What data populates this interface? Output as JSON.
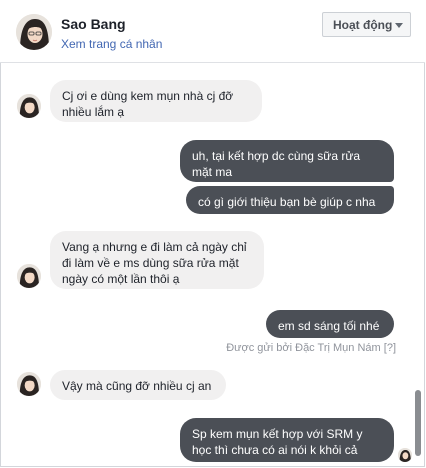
{
  "header": {
    "name": "Sao Bang",
    "profile_link": "Xem trang cá nhân",
    "status_button": "Hoạt động"
  },
  "messages": [
    {
      "side": "in",
      "text_lines": [
        "Cj ơi e dùng kem mụn nhà cj đỡ",
        "nhiều lắm ạ"
      ]
    },
    {
      "side": "out",
      "text_lines": [
        "uh, tại kết hợp dc cùng sữa rửa",
        "mặt ma"
      ]
    },
    {
      "side": "out",
      "text_lines": [
        "có gì giới thiệu  bạn bè giúp c nha"
      ]
    },
    {
      "side": "in",
      "text_lines": [
        "Vang ạ nhưng e đi làm cả ngày chỉ",
        "đi làm về e ms dùng sữa rửa mặt",
        "ngày có một lần thôi ạ"
      ]
    },
    {
      "side": "out",
      "text_lines": [
        "em sd sáng tối nhé"
      ]
    },
    {
      "side": "in",
      "text_lines": [
        "Vậy mà cũng đỡ nhiều cj an"
      ]
    },
    {
      "side": "out",
      "text_lines": [
        "Sp kem mụn kết hợp với SRM y",
        "học thì chưa có ai nói k khỏi cả"
      ]
    }
  ],
  "sent_by": "Được gửi bởi Đặc Trị Mụn Nám",
  "sent_by_help": "[?]",
  "icons": {
    "status_caret": "chevron-down-icon",
    "avatar": "user-avatar"
  }
}
